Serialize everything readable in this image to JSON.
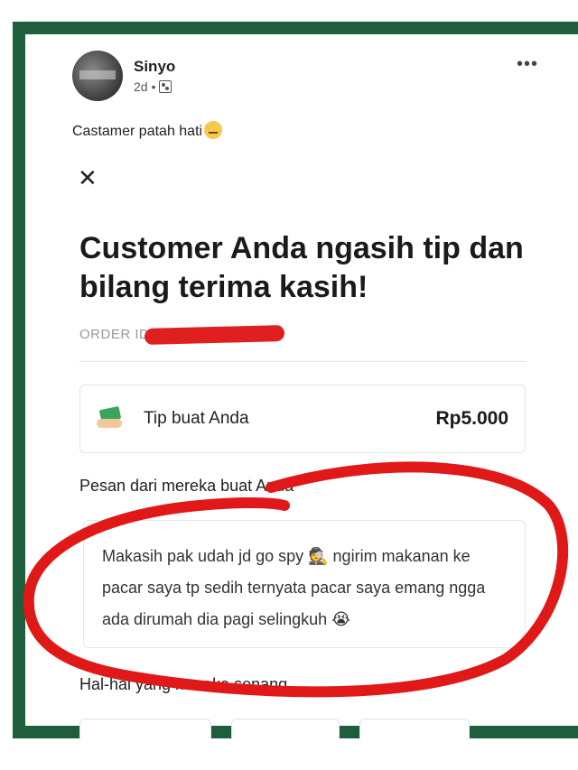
{
  "post": {
    "author": "Sinyo",
    "time": "2d",
    "separator": "•",
    "caption": "Castamer patah hati"
  },
  "screen": {
    "title": "Customer Anda ngasih tip dan bilang terima kasih!",
    "order_label": "ORDER ID",
    "tip_label": "Tip buat Anda",
    "tip_amount": "Rp5.000",
    "message_heading": "Pesan dari mereka buat Anda",
    "message_text": "Makasih pak udah jd go spy 🕵️ ngirim makanan ke pacar saya tp sedih ternyata pacar saya emang ngga ada dirumah dia pagi selingkuh 😭",
    "things_heading": "Hal-hal yang mereka senang"
  },
  "icons": [
    "avatar",
    "more-icon",
    "audience-icon",
    "close-icon",
    "money-icon"
  ],
  "colors": {
    "frame": "#1e5e3c",
    "scribble": "#e01818"
  }
}
